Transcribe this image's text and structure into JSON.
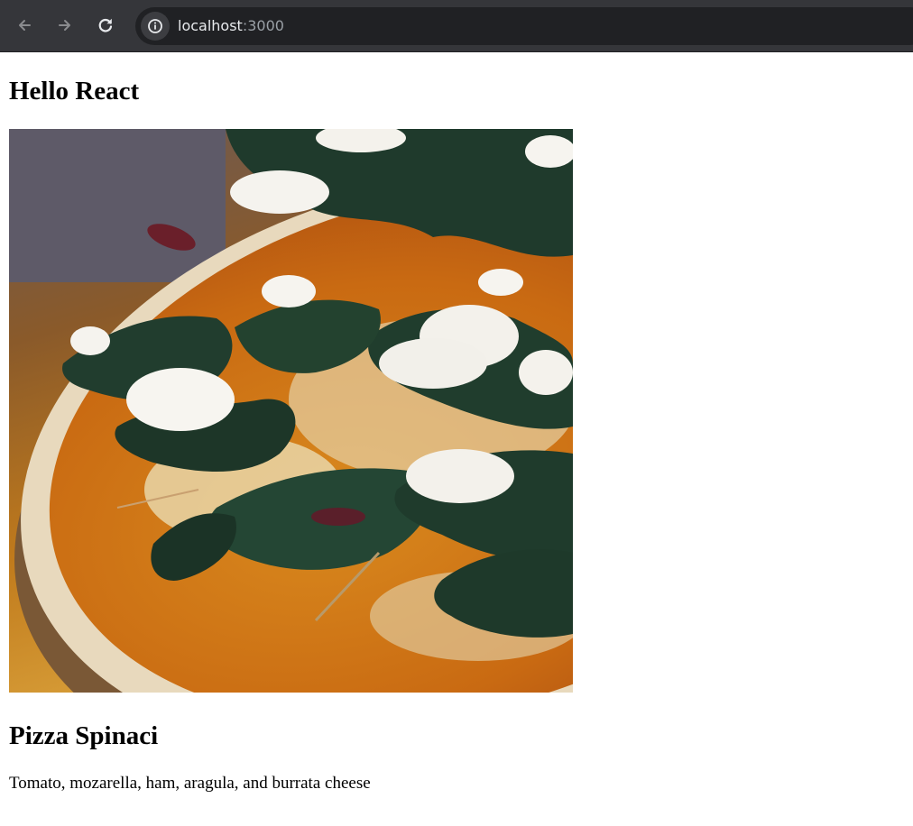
{
  "browser": {
    "url_host": "localhost",
    "url_port": ":3000",
    "icons": {
      "back": "arrow-left-icon",
      "forward": "arrow-right-icon",
      "reload": "reload-icon",
      "site_info": "info-circle-icon"
    },
    "colors": {
      "toolbar": "#35363a",
      "omnibox": "#202124"
    }
  },
  "page": {
    "heading": "Hello React",
    "pizza": {
      "name": "Pizza Spinaci",
      "ingredients": "Tomato, mozarella, ham, aragula, and burrata cheese"
    }
  }
}
